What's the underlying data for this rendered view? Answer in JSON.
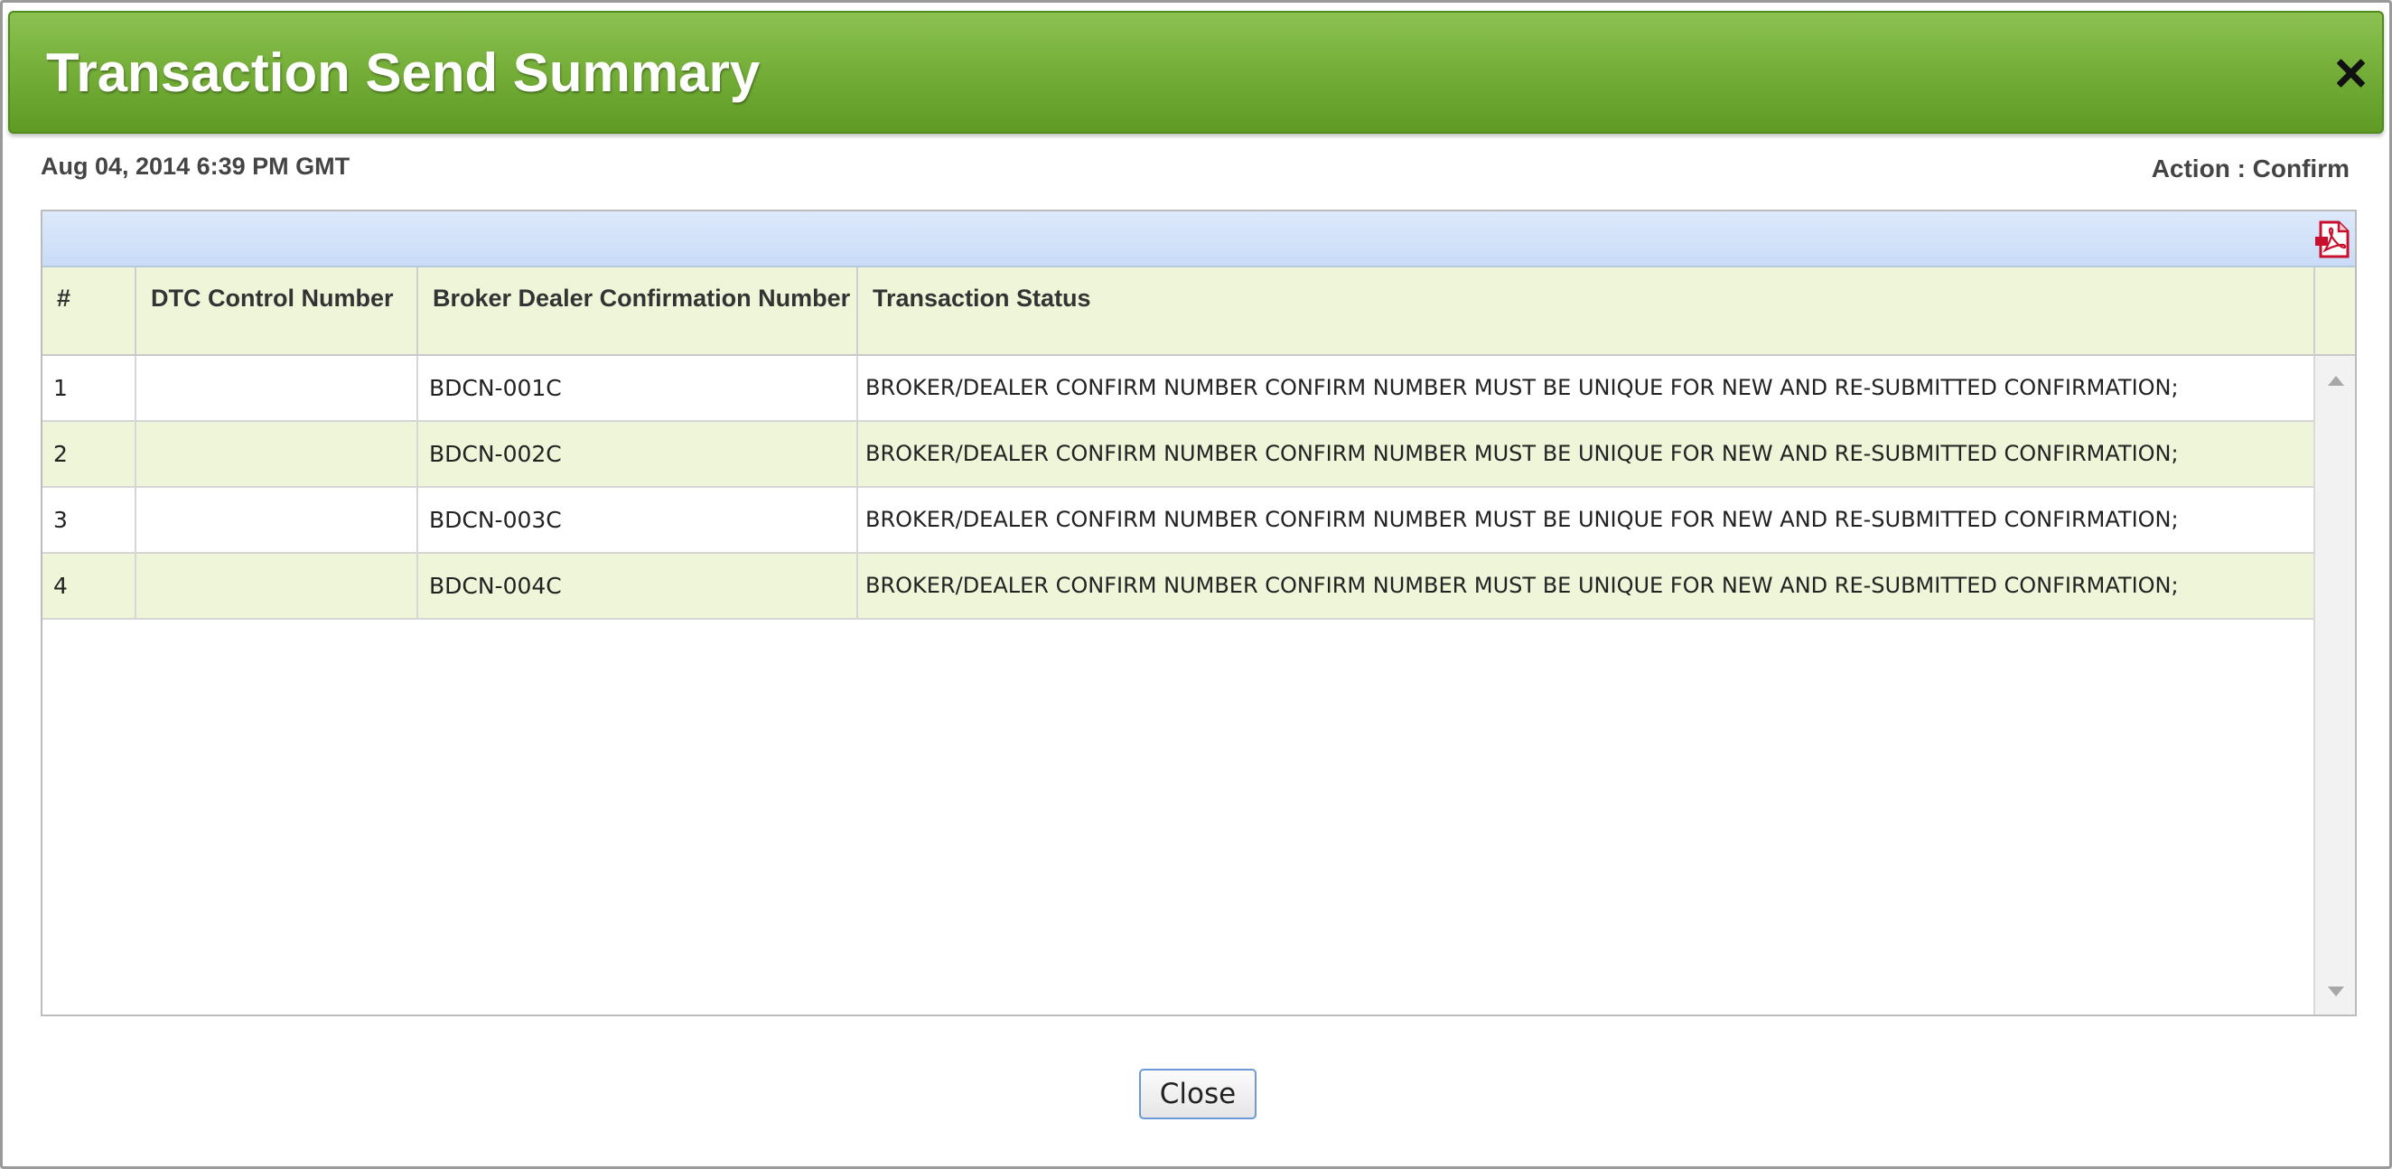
{
  "dialog": {
    "title": "Transaction Send Summary",
    "timestamp": "Aug 04, 2014 6:39 PM GMT",
    "action": "Action : Confirm",
    "close_label": "Close"
  },
  "table": {
    "columns": [
      "#",
      "DTC Control Number",
      "Broker Dealer Confirmation Number",
      "Transaction Status"
    ],
    "rows": [
      {
        "num": "1",
        "dtc": "",
        "bdcn": "BDCN-001C",
        "status": "BROKER/DEALER CONFIRM NUMBER CONFIRM NUMBER MUST BE UNIQUE FOR NEW AND RE-SUBMITTED CONFIRMATION;"
      },
      {
        "num": "2",
        "dtc": "",
        "bdcn": "BDCN-002C",
        "status": "BROKER/DEALER CONFIRM NUMBER CONFIRM NUMBER MUST BE UNIQUE FOR NEW AND RE-SUBMITTED CONFIRMATION;"
      },
      {
        "num": "3",
        "dtc": "",
        "bdcn": "BDCN-003C",
        "status": "BROKER/DEALER CONFIRM NUMBER CONFIRM NUMBER MUST BE UNIQUE FOR NEW AND RE-SUBMITTED CONFIRMATION;"
      },
      {
        "num": "4",
        "dtc": "",
        "bdcn": "BDCN-004C",
        "status": "BROKER/DEALER CONFIRM NUMBER CONFIRM NUMBER MUST BE UNIQUE FOR NEW AND RE-SUBMITTED CONFIRMATION;"
      }
    ]
  },
  "icons": {
    "close": "close-icon",
    "export": "pdf-export-icon"
  },
  "colors": {
    "title_bar": "#76b03a",
    "toolbar": "#c9dcf6",
    "alt_row": "#eef5d8",
    "pdf_red": "#c8102e"
  }
}
